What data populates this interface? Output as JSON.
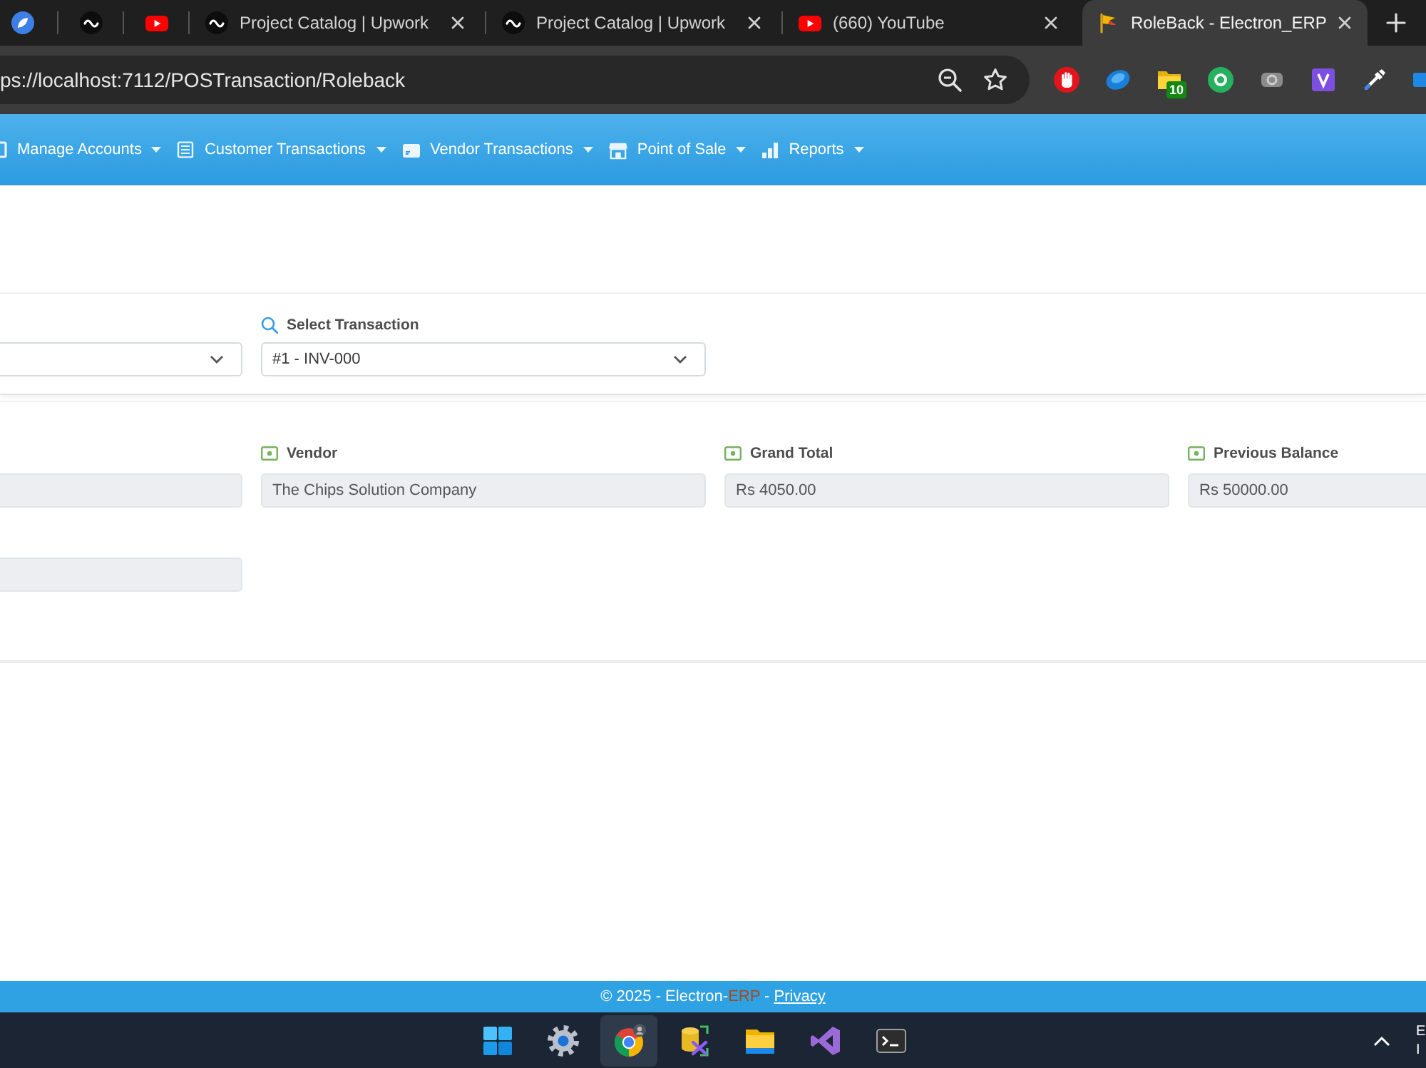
{
  "browser": {
    "tabs": [
      {
        "kind": "pinned",
        "selected": false
      },
      {
        "kind": "pinned",
        "selected": false
      },
      {
        "kind": "pinned",
        "selected": false
      },
      {
        "kind": "page",
        "title": "Project Catalog | Upwork",
        "selected": false
      },
      {
        "kind": "page",
        "title": "Project Catalog | Upwork",
        "selected": false
      },
      {
        "kind": "page",
        "title": "(660) YouTube",
        "selected": false
      },
      {
        "kind": "page",
        "title": "RoleBack - Electron_ERP",
        "selected": true
      }
    ],
    "address": "ps://localhost:7112/POSTransaction/Roleback",
    "extension_badge": "10"
  },
  "navbar": {
    "items": [
      {
        "label": "Manage Accounts"
      },
      {
        "label": "Customer Transactions"
      },
      {
        "label": "Vendor Transactions"
      },
      {
        "label": "Point of Sale"
      },
      {
        "label": "Reports"
      }
    ]
  },
  "filters": [
    {
      "readonly": false
    },
    {
      "label": "Select Transaction",
      "value": "#1 - INV-000",
      "readonly": false
    }
  ],
  "details": [
    {
      "readonly": true
    },
    {
      "label": "Vendor",
      "value": "The Chips Solution Company",
      "readonly": true
    },
    {
      "label": "Grand Total",
      "value": "Rs 4050.00",
      "readonly": true
    },
    {
      "label": "Previous Balance",
      "value": "Rs 50000.00",
      "readonly": true
    },
    {
      "readonly": true
    }
  ],
  "footer": {
    "copyright": "© 2025 - Electron-",
    "accent": "ERP",
    "separator": " - ",
    "link": "Privacy"
  },
  "taskbar": {
    "apps": [
      {
        "selected": false
      },
      {
        "selected": false
      },
      {
        "selected": true
      },
      {
        "selected": false
      },
      {
        "selected": false
      },
      {
        "selected": false
      },
      {
        "selected": false
      }
    ],
    "tray_text": [
      "E",
      "I"
    ]
  }
}
